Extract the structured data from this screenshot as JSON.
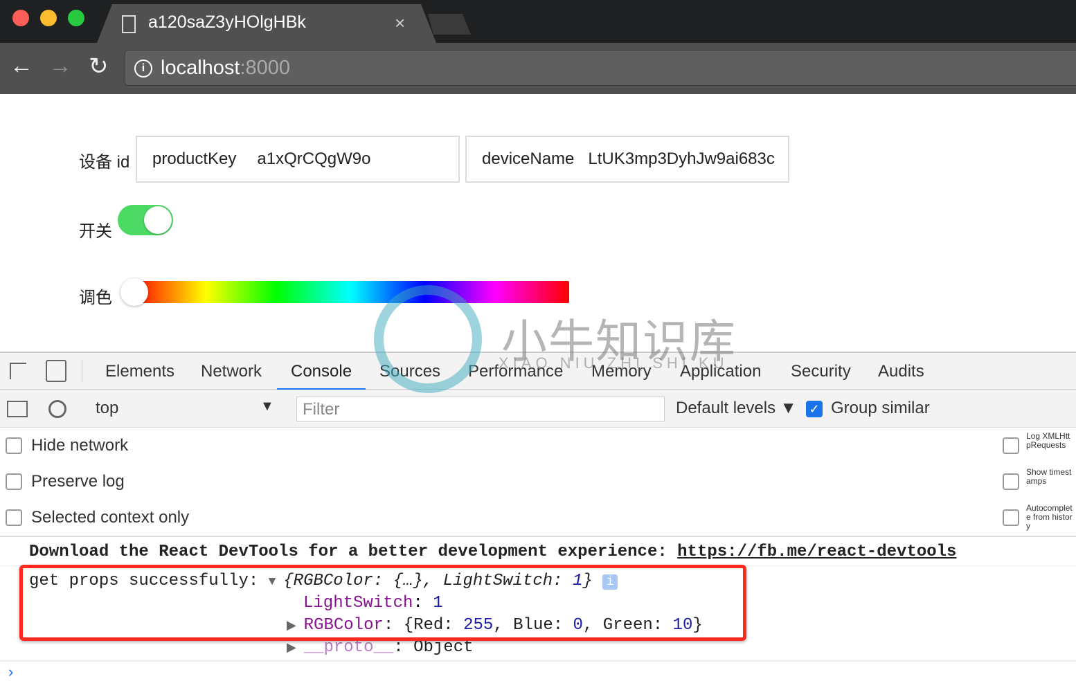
{
  "browser": {
    "tab_title": "a120saZ3yHOlgHBk",
    "url_host": "localhost",
    "url_port": ":8000",
    "icons": [
      "file-icon",
      "close-icon",
      "back-icon",
      "forward-icon",
      "reload-icon",
      "info-icon"
    ]
  },
  "page": {
    "device_label": "设备 id",
    "product_key_label": "productKey",
    "product_key": "a1xQrCQgW9o",
    "device_name_label": "deviceName",
    "device_name": "LtUK3mp3DyhJw9ai683c",
    "switch_label": "开关",
    "switch_on": true,
    "color_label": "调色",
    "hue_value": 0,
    "accent": "#4cd964"
  },
  "watermark": {
    "cn": "小牛知识库",
    "en": "XIAO NIU ZHI SHI KU"
  },
  "devtools": {
    "tabs": [
      "Elements",
      "Network",
      "Console",
      "Sources",
      "Performance",
      "Memory",
      "Application",
      "Security",
      "Audits"
    ],
    "active_tab": "Console",
    "context": "top",
    "filter_placeholder": "Filter",
    "levels": "Default levels ▼",
    "group_similar": "Group similar",
    "group_similar_checked": true,
    "left_options": [
      "Hide network",
      "Preserve log",
      "Selected context only"
    ],
    "right_options": [
      "Log XMLHttpRequests",
      "Show timestamps",
      "Autocomplete from history"
    ],
    "messages": {
      "react_text": "Download the React DevTools for a better development experience: ",
      "react_link": "https://fb.me/react-devtools",
      "log_prefix": "get props successfully: ",
      "summary_a": "{RGBColor: {…}, LightSwitch: ",
      "summary_num": "1",
      "summary_b": "}",
      "ls_key": "LightSwitch",
      "ls_val": "1",
      "rgb_key": "RGBColor",
      "rgb_open": "{Red: ",
      "red": "255",
      "blue_lbl": ", Blue: ",
      "blue": "0",
      "green_lbl": ", Green: ",
      "green": "10",
      "rgb_close": "}",
      "proto_key": "__proto__",
      "proto_val": "Object"
    }
  }
}
